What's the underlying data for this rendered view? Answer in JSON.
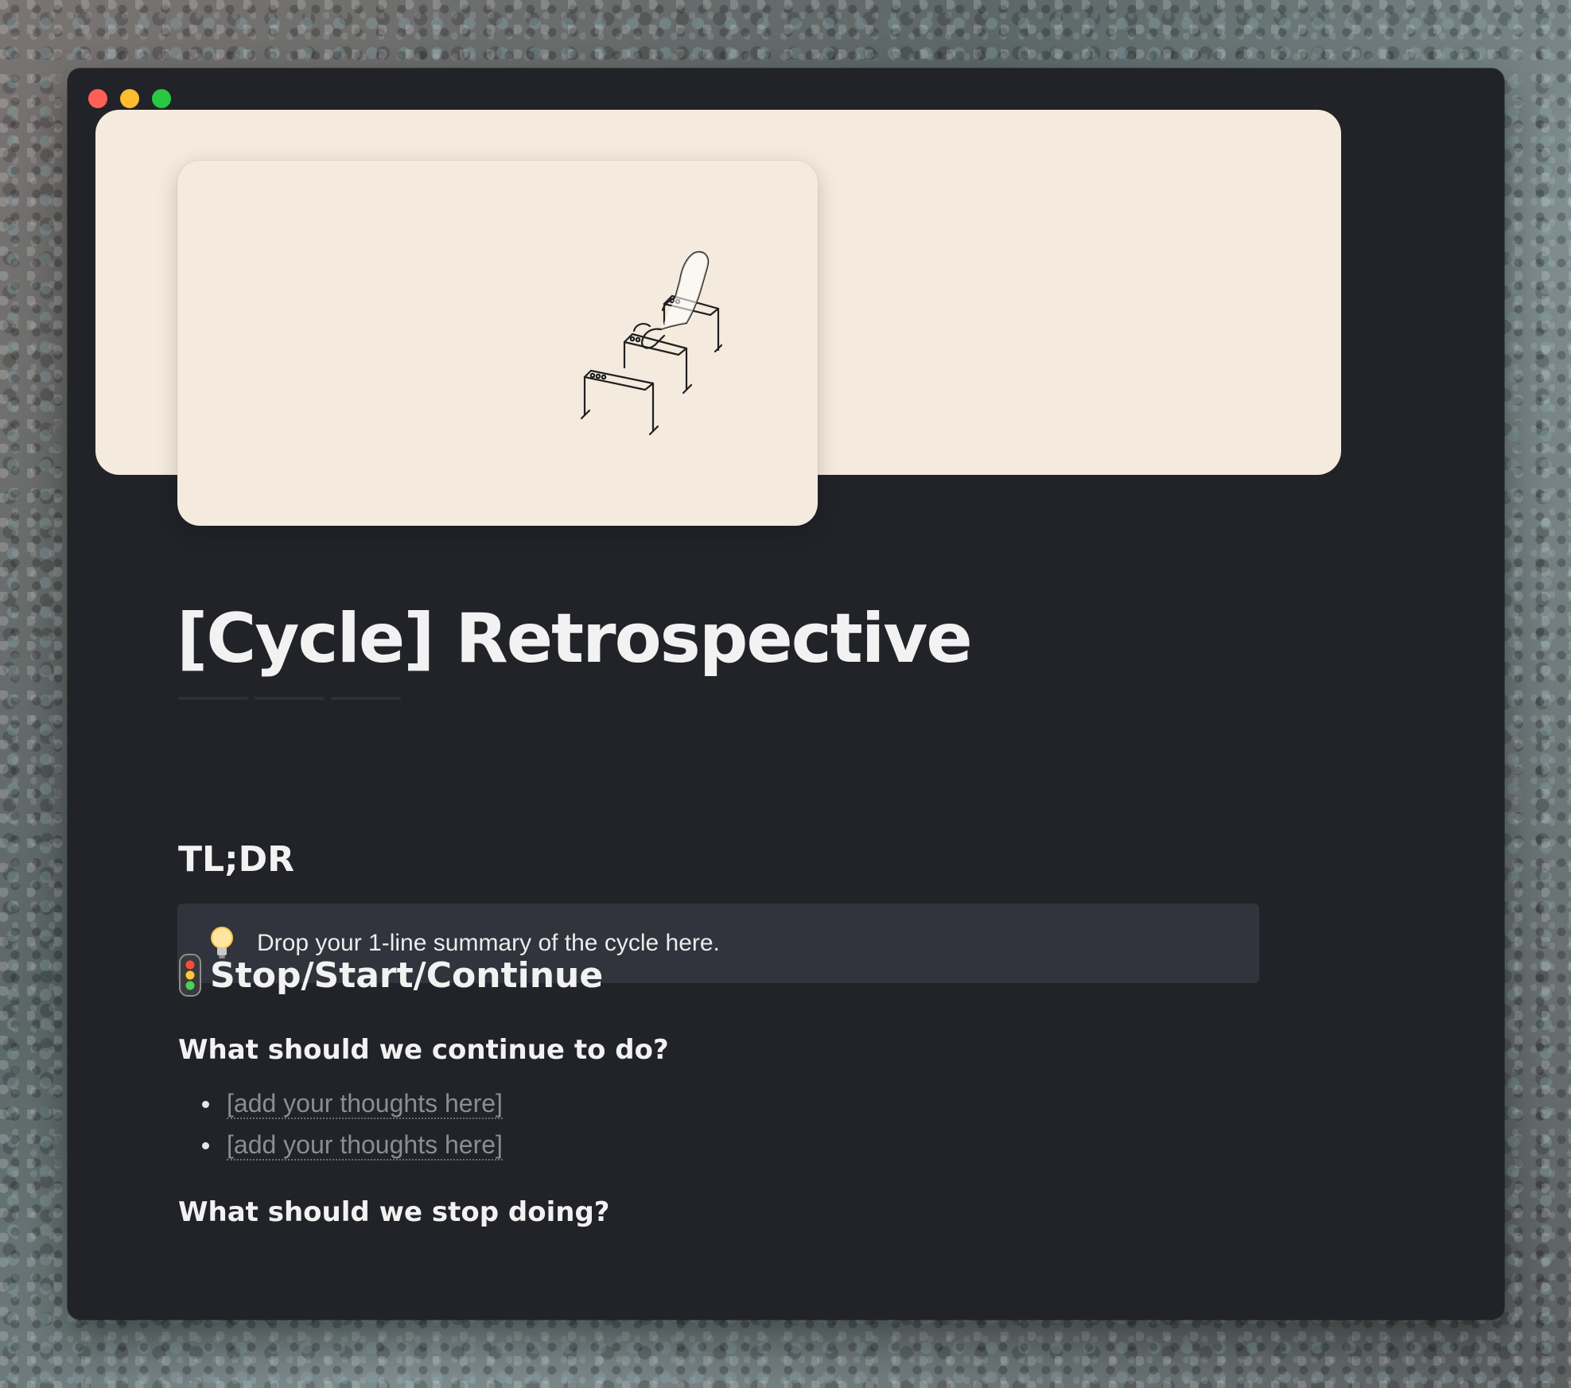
{
  "window": {
    "controls": [
      "close",
      "minimize",
      "zoom"
    ]
  },
  "cover": {
    "illustration": "hurdles-illustration"
  },
  "page": {
    "title": "[Cycle] Retrospective"
  },
  "tldr": {
    "heading": "TL;DR",
    "callout_icon": "lightbulb-icon",
    "callout_text": "Drop your 1-line summary of the cycle here."
  },
  "stop_start_continue": {
    "icon": "traffic-light-icon",
    "heading": "Stop/Start/Continue",
    "continue": {
      "question": "What should we continue to do?",
      "items": [
        "[add your thoughts here]",
        "[add your thoughts here]"
      ]
    },
    "stop": {
      "question": "What should we stop doing?"
    }
  },
  "colors": {
    "window_bg": "#212328",
    "cover_bg": "#f4eadd",
    "callout_bg": "#31343c",
    "text": "#f2f2f2",
    "placeholder": "#8a8d93"
  }
}
